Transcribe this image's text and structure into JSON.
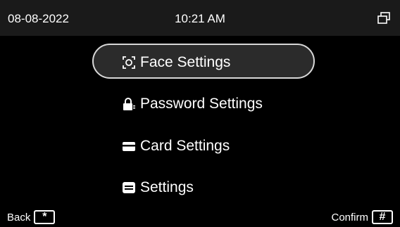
{
  "status_bar": {
    "date": "08-08-2022",
    "time": "10:21 AM",
    "right_icon": "windows-icon"
  },
  "menu": {
    "selected_index": 0,
    "items": [
      {
        "label": "Face Settings",
        "icon": "face-scan-icon"
      },
      {
        "label": "Password Settings",
        "icon": "lock-icon"
      },
      {
        "label": "Card Settings",
        "icon": "card-icon"
      },
      {
        "label": "Settings",
        "icon": "settings-icon"
      }
    ]
  },
  "footer": {
    "back_label": "Back",
    "back_key": "*",
    "confirm_label": "Confirm",
    "confirm_key": "#"
  },
  "colors": {
    "background": "#000000",
    "status_bar_bg": "#1a1a1a",
    "selection_border": "#d8d8d8",
    "selection_fill": "#2b2b2b",
    "text": "#ffffff"
  }
}
